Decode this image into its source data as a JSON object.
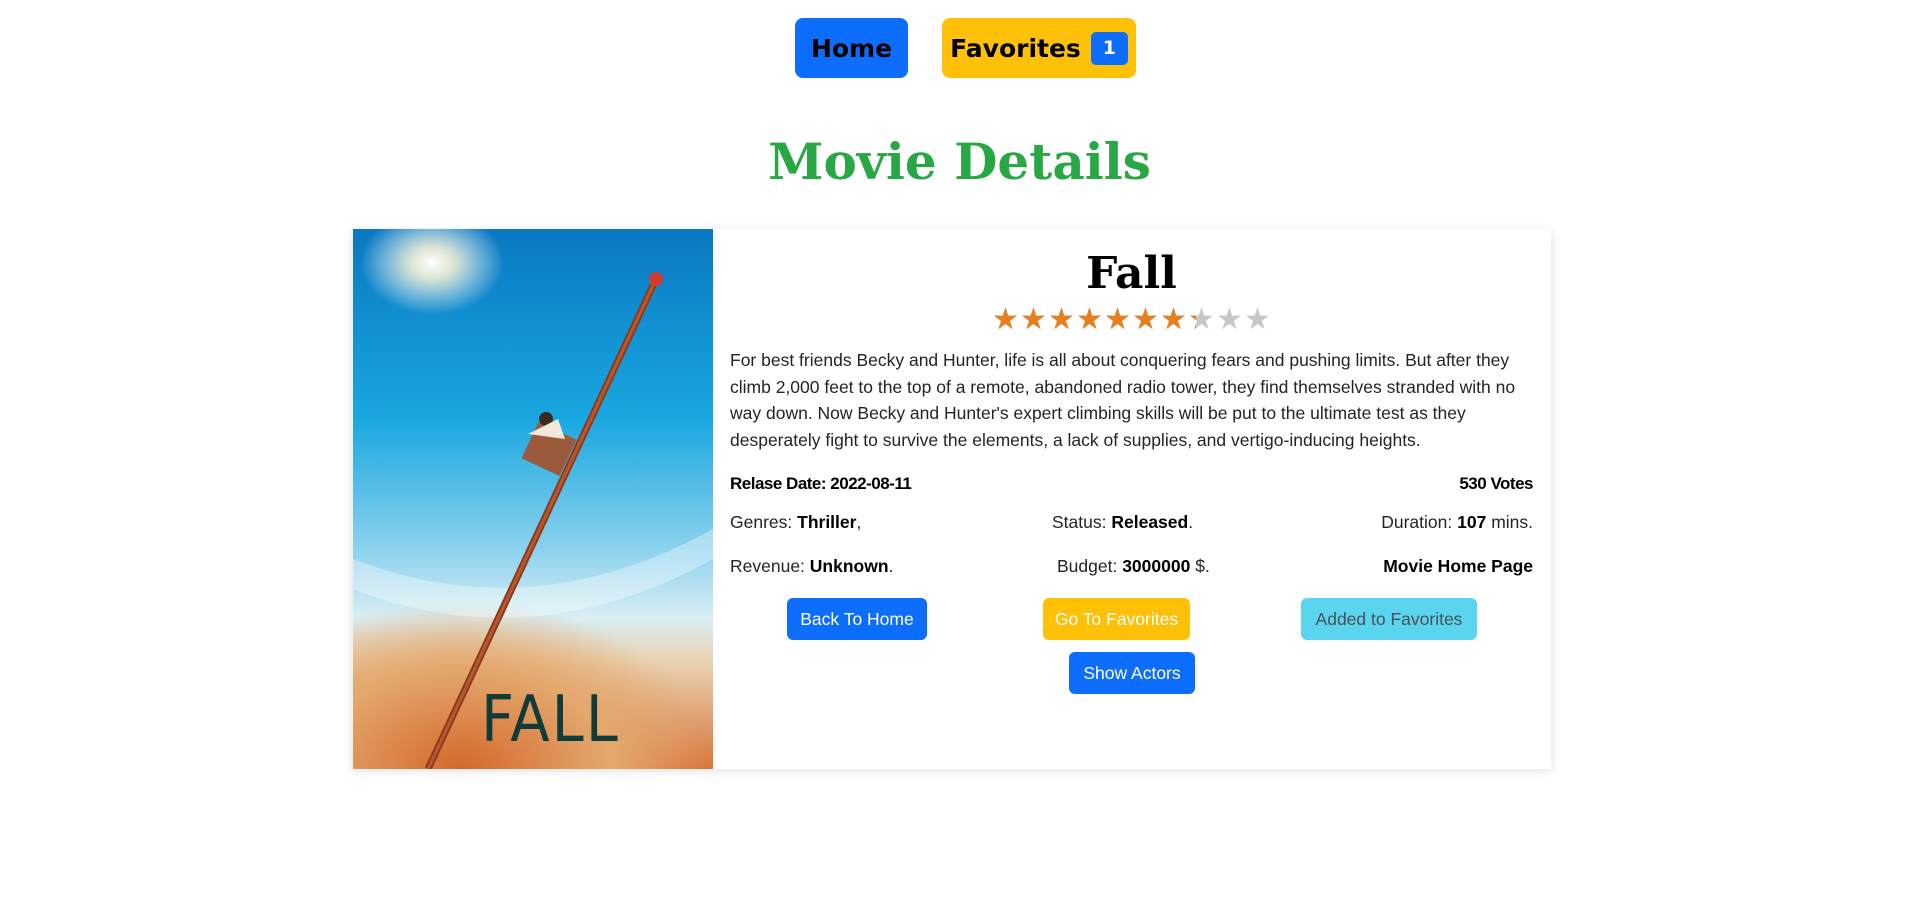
{
  "nav": {
    "home_label": "Home",
    "favorites_label": "Favorites",
    "favorites_count": "1"
  },
  "page_title": "Movie Details",
  "movie": {
    "title": "Fall",
    "poster_text": "FALL",
    "rating_fraction": 0.73,
    "star_count": 10,
    "overview": "For best friends Becky and Hunter, life is all about conquering fears and pushing limits. But after they climb 2,000 feet to the top of a remote, abandoned radio tower, they find themselves stranded with no way down. Now Becky and Hunter's expert climbing skills will be put to the ultimate test as they desperately fight to survive the elements, a lack of supplies, and vertigo-inducing heights.",
    "release_label": "Relase Date:",
    "release_date": "2022-08-11",
    "votes": "530",
    "votes_label": "Votes",
    "genres_label": "Genres:",
    "genres_value": "Thriller",
    "genres_suffix": ",",
    "status_label": "Status:",
    "status_value": "Released",
    "status_suffix": ".",
    "duration_label": "Duration:",
    "duration_value": "107",
    "duration_suffix": "mins.",
    "revenue_label": "Revenue:",
    "revenue_value": "Unknown",
    "revenue_suffix": ".",
    "budget_label": "Budget:",
    "budget_value": "3000000",
    "budget_suffix": "$.",
    "homepage_label": "Movie Home Page"
  },
  "buttons": {
    "back": "Back To Home",
    "go_favorites": "Go To Favorites",
    "added_favorites": "Added to Favorites",
    "show_actors": "Show Actors"
  },
  "colors": {
    "primary": "#0d6efd",
    "warning": "#ffc107",
    "info": "#5bd5ef",
    "title_green": "#28a745",
    "star": "#e67e22"
  }
}
